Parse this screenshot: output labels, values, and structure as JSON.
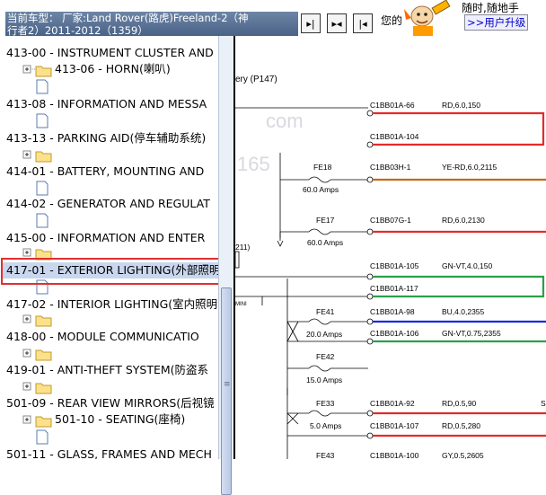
{
  "header": {
    "title_line1": "当前车型：  厂家:Land Rover(路虎)Freeland-2（神",
    "title_line2": "行者2）2011-2012（1359）",
    "btn_prev_glyph": "▸|",
    "btn_sync_glyph": "▸◂",
    "btn_next_glyph": "|◂",
    "hint_text": "您的",
    "ad_line1": "随时,随地手",
    "ad_line2": ">>用户升级"
  },
  "tree": {
    "items": [
      {
        "label": "413-00 - INSTRUMENT CLUSTER AND"
      },
      {
        "label": "413-06 - HORN(喇叭)"
      },
      {
        "label": "413-08 - INFORMATION AND MESSA"
      },
      {
        "label": "413-13 - PARKING AID(停车辅助系统)"
      },
      {
        "label": "414-01 - BATTERY, MOUNTING AND"
      },
      {
        "label": "414-02 - GENERATOR AND REGULAT"
      },
      {
        "label": "415-00 - INFORMATION AND ENTER"
      },
      {
        "label": "417-01 - EXTERIOR LIGHTING(外部照明"
      },
      {
        "label": "417-02 - INTERIOR LIGHTING(室内照明"
      },
      {
        "label": "418-00 - MODULE COMMUNICATIO"
      },
      {
        "label": "419-01 - ANTI-THEFT SYSTEM(防盗系"
      },
      {
        "label": "501-09 - REAR VIEW MIRRORS(后视镜"
      },
      {
        "label": "501-10 - SEATING(座椅)"
      },
      {
        "label": "501-11 - GLASS, FRAMES AND MECH"
      }
    ]
  },
  "diagram": {
    "title_fragment": "ery (P147)",
    "watermark1": "com",
    "watermark2": "165",
    "left_label": "211)",
    "left_label2": "MINI",
    "connectors": [
      {
        "id": "C1BB01A-66",
        "wire": "RD,6.0,150"
      },
      {
        "id": "C1BB01A-104",
        "wire": ""
      },
      {
        "id": "C1BB03H-1",
        "wire": "YE-RD,6.0,2115"
      },
      {
        "id": "C1BB07G-1",
        "wire": "RD,6.0,2130"
      },
      {
        "id": "C1BB01A-105",
        "wire": "GN-VT,4.0,150"
      },
      {
        "id": "C1BB01A-117",
        "wire": ""
      },
      {
        "id": "C1BB01A-98",
        "wire": "BU,4.0,2355"
      },
      {
        "id": "C1BB01A-106",
        "wire": "GN-VT,0.75,2355"
      },
      {
        "id": "C1BB01A-92",
        "wire": "RD,0.5,90"
      },
      {
        "id": "C1BB01A-107",
        "wire": "RD,0.5,280"
      },
      {
        "id": "C1BB01A-100",
        "wire": "GY,0.5,2605"
      }
    ],
    "fuses": [
      {
        "name": "FE18",
        "rating": "60.0 Amps"
      },
      {
        "name": "FE17",
        "rating": "60.0 Amps"
      },
      {
        "name": "FE41",
        "rating": "20.0 Amps"
      },
      {
        "name": "FE42",
        "rating": "15.0 Amps"
      },
      {
        "name": "FE33",
        "rating": "5.0 Amps"
      },
      {
        "name": "FE43",
        "rating": ""
      }
    ],
    "right_edge_letter": "S"
  }
}
